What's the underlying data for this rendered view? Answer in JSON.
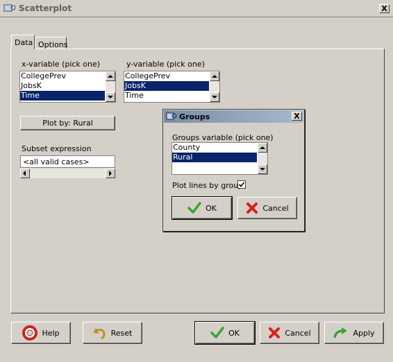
{
  "window": {
    "title": "Scatterplot",
    "close": "X"
  },
  "tabs": [
    "Data",
    "Options"
  ],
  "xvar": {
    "label": "x-variable (pick one)",
    "items": [
      "CollegePrev",
      "JobsK",
      "Time"
    ],
    "selected": 2
  },
  "yvar": {
    "label": "y-variable (pick one)",
    "items": [
      "CollegePrev",
      "JobsK",
      "Time"
    ],
    "selected": 1
  },
  "plot_by_button": "Plot by: Rural",
  "subset": {
    "label": "Subset expression",
    "value": "<all valid cases>"
  },
  "groups_dialog": {
    "title": "Groups",
    "close": "X",
    "label": "Groups variable (pick one)",
    "items": [
      "County",
      "Rural"
    ],
    "selected": 1,
    "plot_lines_label": "Plot lines by group",
    "plot_lines_checked": true,
    "ok": "OK",
    "cancel": "Cancel"
  },
  "buttons": {
    "help": "Help",
    "reset": "Reset",
    "ok": "OK",
    "cancel": "Cancel",
    "apply": "Apply"
  },
  "colors": {
    "selection": "#0a246a",
    "ok_green": "#3aa33a",
    "cancel_red": "#d42020"
  }
}
